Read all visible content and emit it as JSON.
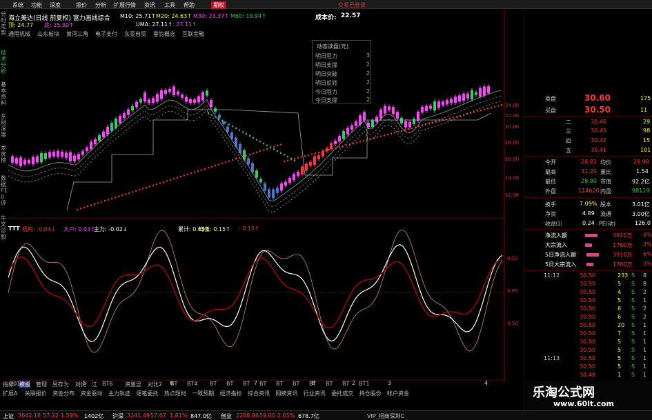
{
  "menu": {
    "items": [
      "系统",
      "功能",
      "深度",
      "报价",
      "分析",
      "扩展行情",
      "资讯",
      "工具",
      "帮助"
    ],
    "active": "期权",
    "right": "交易已登录"
  },
  "vtabs": [
    "分时走势",
    "技术分析",
    "基本资料",
    "东财深度",
    "龙虎榜",
    "数据F10评",
    "牛叉诊股"
  ],
  "kline": {
    "title": "海立美达(日线 前复权) 富力画线综合",
    "ma10": "M10: 25.71↑",
    "ma20": "M20: 24.63↑",
    "ma30": "M30: 23.37↑",
    "ma60": "M60: 19.94↑",
    "cost_label": "成本价:",
    "cost_value": "22.57",
    "line2_a": "顶: 24.77",
    "line2_b": "底: 25.90↑",
    "line2_c": "UMA: 27.11↑",
    "line2_d": ": 27.11↑",
    "concepts": [
      "通用机械",
      "山东板块",
      "黄河三角",
      "电子支付",
      "东亚自贸",
      "垂钓概念",
      "互联金融"
    ],
    "panel_title": "动态读盘(元)",
    "panel_rows": [
      "明日阻力",
      "明日支撑",
      "明日突破",
      "明日反转",
      "今日阻力",
      "今日支撑"
    ],
    "panel_vals": [
      "3",
      "2",
      "2",
      "2",
      "2",
      "2"
    ],
    "y_ticks": [
      "24.00",
      "22.00",
      "20.00",
      "18.00",
      "16.00",
      "14.00",
      "12.00"
    ]
  },
  "indicator": {
    "name": "TTT",
    "items": [
      "机构: -0.04↓",
      "大户: 0.03↑",
      "主力: -0.02↓",
      "累计: 0.65↑",
      "均值: 0.15↑",
      ": 0.15↑"
    ],
    "y_ticks": [
      "0.50",
      "0.00",
      "-0.50"
    ],
    "x_labels": [
      "2015年",
      "5",
      "6",
      "7",
      "8",
      "2",
      "3",
      "4"
    ]
  },
  "quote": {
    "sell_label": "卖盘",
    "sell_price": "30.60",
    "sell_vol": "175",
    "buy_label": "买盘",
    "buy_price": "30.50",
    "buy_vol": "11",
    "levels": [
      {
        "name": "二",
        "price": "30.46",
        "vol": "29"
      },
      {
        "name": "三",
        "price": "30.45",
        "vol": "98"
      },
      {
        "name": "四",
        "price": "30.42",
        "vol": "15"
      },
      {
        "name": "五",
        "price": "30.41",
        "vol": "101"
      }
    ],
    "stats": [
      {
        "k1": "今开",
        "v1": "28.81",
        "k2": "均价",
        "v2": "29.99"
      },
      {
        "k1": "最高",
        "v1": "31.20",
        "k2": "量比",
        "v2": "1.54"
      },
      {
        "k1": "最低",
        "v1": "28.80",
        "k2": "市值",
        "v2": "92.2亿"
      },
      {
        "k1": "外盘",
        "v1": "114620",
        "k2": "内盘",
        "v2": "98119"
      }
    ],
    "stats2": [
      {
        "k1": "换手",
        "v1": "7.09%",
        "k2": "股本",
        "v2": "3.01亿"
      },
      {
        "k1": "净资",
        "v1": "4.89",
        "k2": "流通",
        "v2": "3.00亿"
      },
      {
        "k1": "收益⑴",
        "v1": "0.24",
        "k2": "PE(动)",
        "v2": "126.0"
      }
    ],
    "flows": [
      {
        "k": "净流入额",
        "v": "3910万",
        "p": "6%"
      },
      {
        "k": "大宗流入",
        "v": "1760万",
        "p": "3%"
      },
      {
        "k": "5日净流入额",
        "v": "3910万",
        "p": "6%"
      },
      {
        "k": "5日大宗流入",
        "v": "1760万",
        "p": "3%"
      }
    ],
    "ticks": [
      {
        "t": "11:12",
        "p": "30.50",
        "v": "233",
        "d": "S",
        "n": "8"
      },
      {
        "t": "",
        "p": "30.50",
        "v": "5",
        "d": "S",
        "n": "8"
      },
      {
        "t": "",
        "p": "30.50",
        "v": "4",
        "d": "S",
        "n": "2"
      },
      {
        "t": "",
        "p": "30.50",
        "v": "5",
        "d": "S",
        "n": "1"
      },
      {
        "t": "",
        "p": "30.50",
        "v": "6",
        "d": "S",
        "n": "2"
      },
      {
        "t": "",
        "p": "30.50",
        "v": "6",
        "d": "S",
        "n": "2"
      },
      {
        "t": "",
        "p": "30.50",
        "v": "20",
        "d": "S",
        "n": "1"
      },
      {
        "t": "",
        "p": "30.50",
        "v": "7",
        "d": "S",
        "n": "1"
      },
      {
        "t": "",
        "p": "30.50",
        "v": "5",
        "d": "S",
        "n": "1"
      },
      {
        "t": "",
        "p": "30.50",
        "v": "5",
        "d": "S",
        "n": "1"
      },
      {
        "t": "11:13",
        "p": "30.50",
        "v": "5",
        "d": "S",
        "n": "1"
      },
      {
        "t": "",
        "p": "30.50",
        "v": "5",
        "d": "S",
        "n": "1"
      },
      {
        "t": "",
        "p": "30.46",
        "v": "1",
        "d": "S",
        "n": "1"
      },
      {
        "t": "",
        "p": "30.46",
        "v": "4",
        "d": "S",
        "n": "1"
      }
    ]
  },
  "tabbar": {
    "row1": [
      "指标",
      "模板",
      "管理",
      "另存为",
      "对比",
      "江",
      "BT6",
      "资量显",
      "对比2",
      "BT",
      "BT4",
      "BT",
      "BT",
      "BT",
      "BT",
      "BT",
      "BT",
      "BT",
      "BT",
      "BT",
      "BT1"
    ],
    "row1_active": "模板",
    "row2": [
      "扩展A",
      "关联报价",
      "资金分布",
      "资金驱动",
      "主力轨迹",
      "逐笔委托",
      "热点题材",
      "一致预期",
      "经济指标",
      "综合资讯",
      "网摘资讯",
      "行业资讯",
      "委托成交",
      "持仓股份",
      "帐户资金"
    ]
  },
  "status": [
    {
      "label": "上证",
      "value": "3642.18",
      "chg": "57.22",
      "pct": "1.59%",
      "amt": "1402亿"
    },
    {
      "label": "沪深",
      "value": "3241.49",
      "chg": "57.67",
      "pct": "1.81%",
      "amt": "847.0亿"
    },
    {
      "label": "创业",
      "value": "2288.86",
      "chg": "59.00",
      "pct": "2.65%",
      "amt": "678.7亿"
    }
  ],
  "status_right": "VIP_招商深圳C",
  "watermark": {
    "title": "乐淘公式网",
    "url": "www.60lt.com"
  },
  "colors": {
    "up": "#ff3333",
    "down": "#33cc66",
    "magenta": "#ff44ff",
    "blue": "#5599ff",
    "yellow": "#ffff33"
  }
}
